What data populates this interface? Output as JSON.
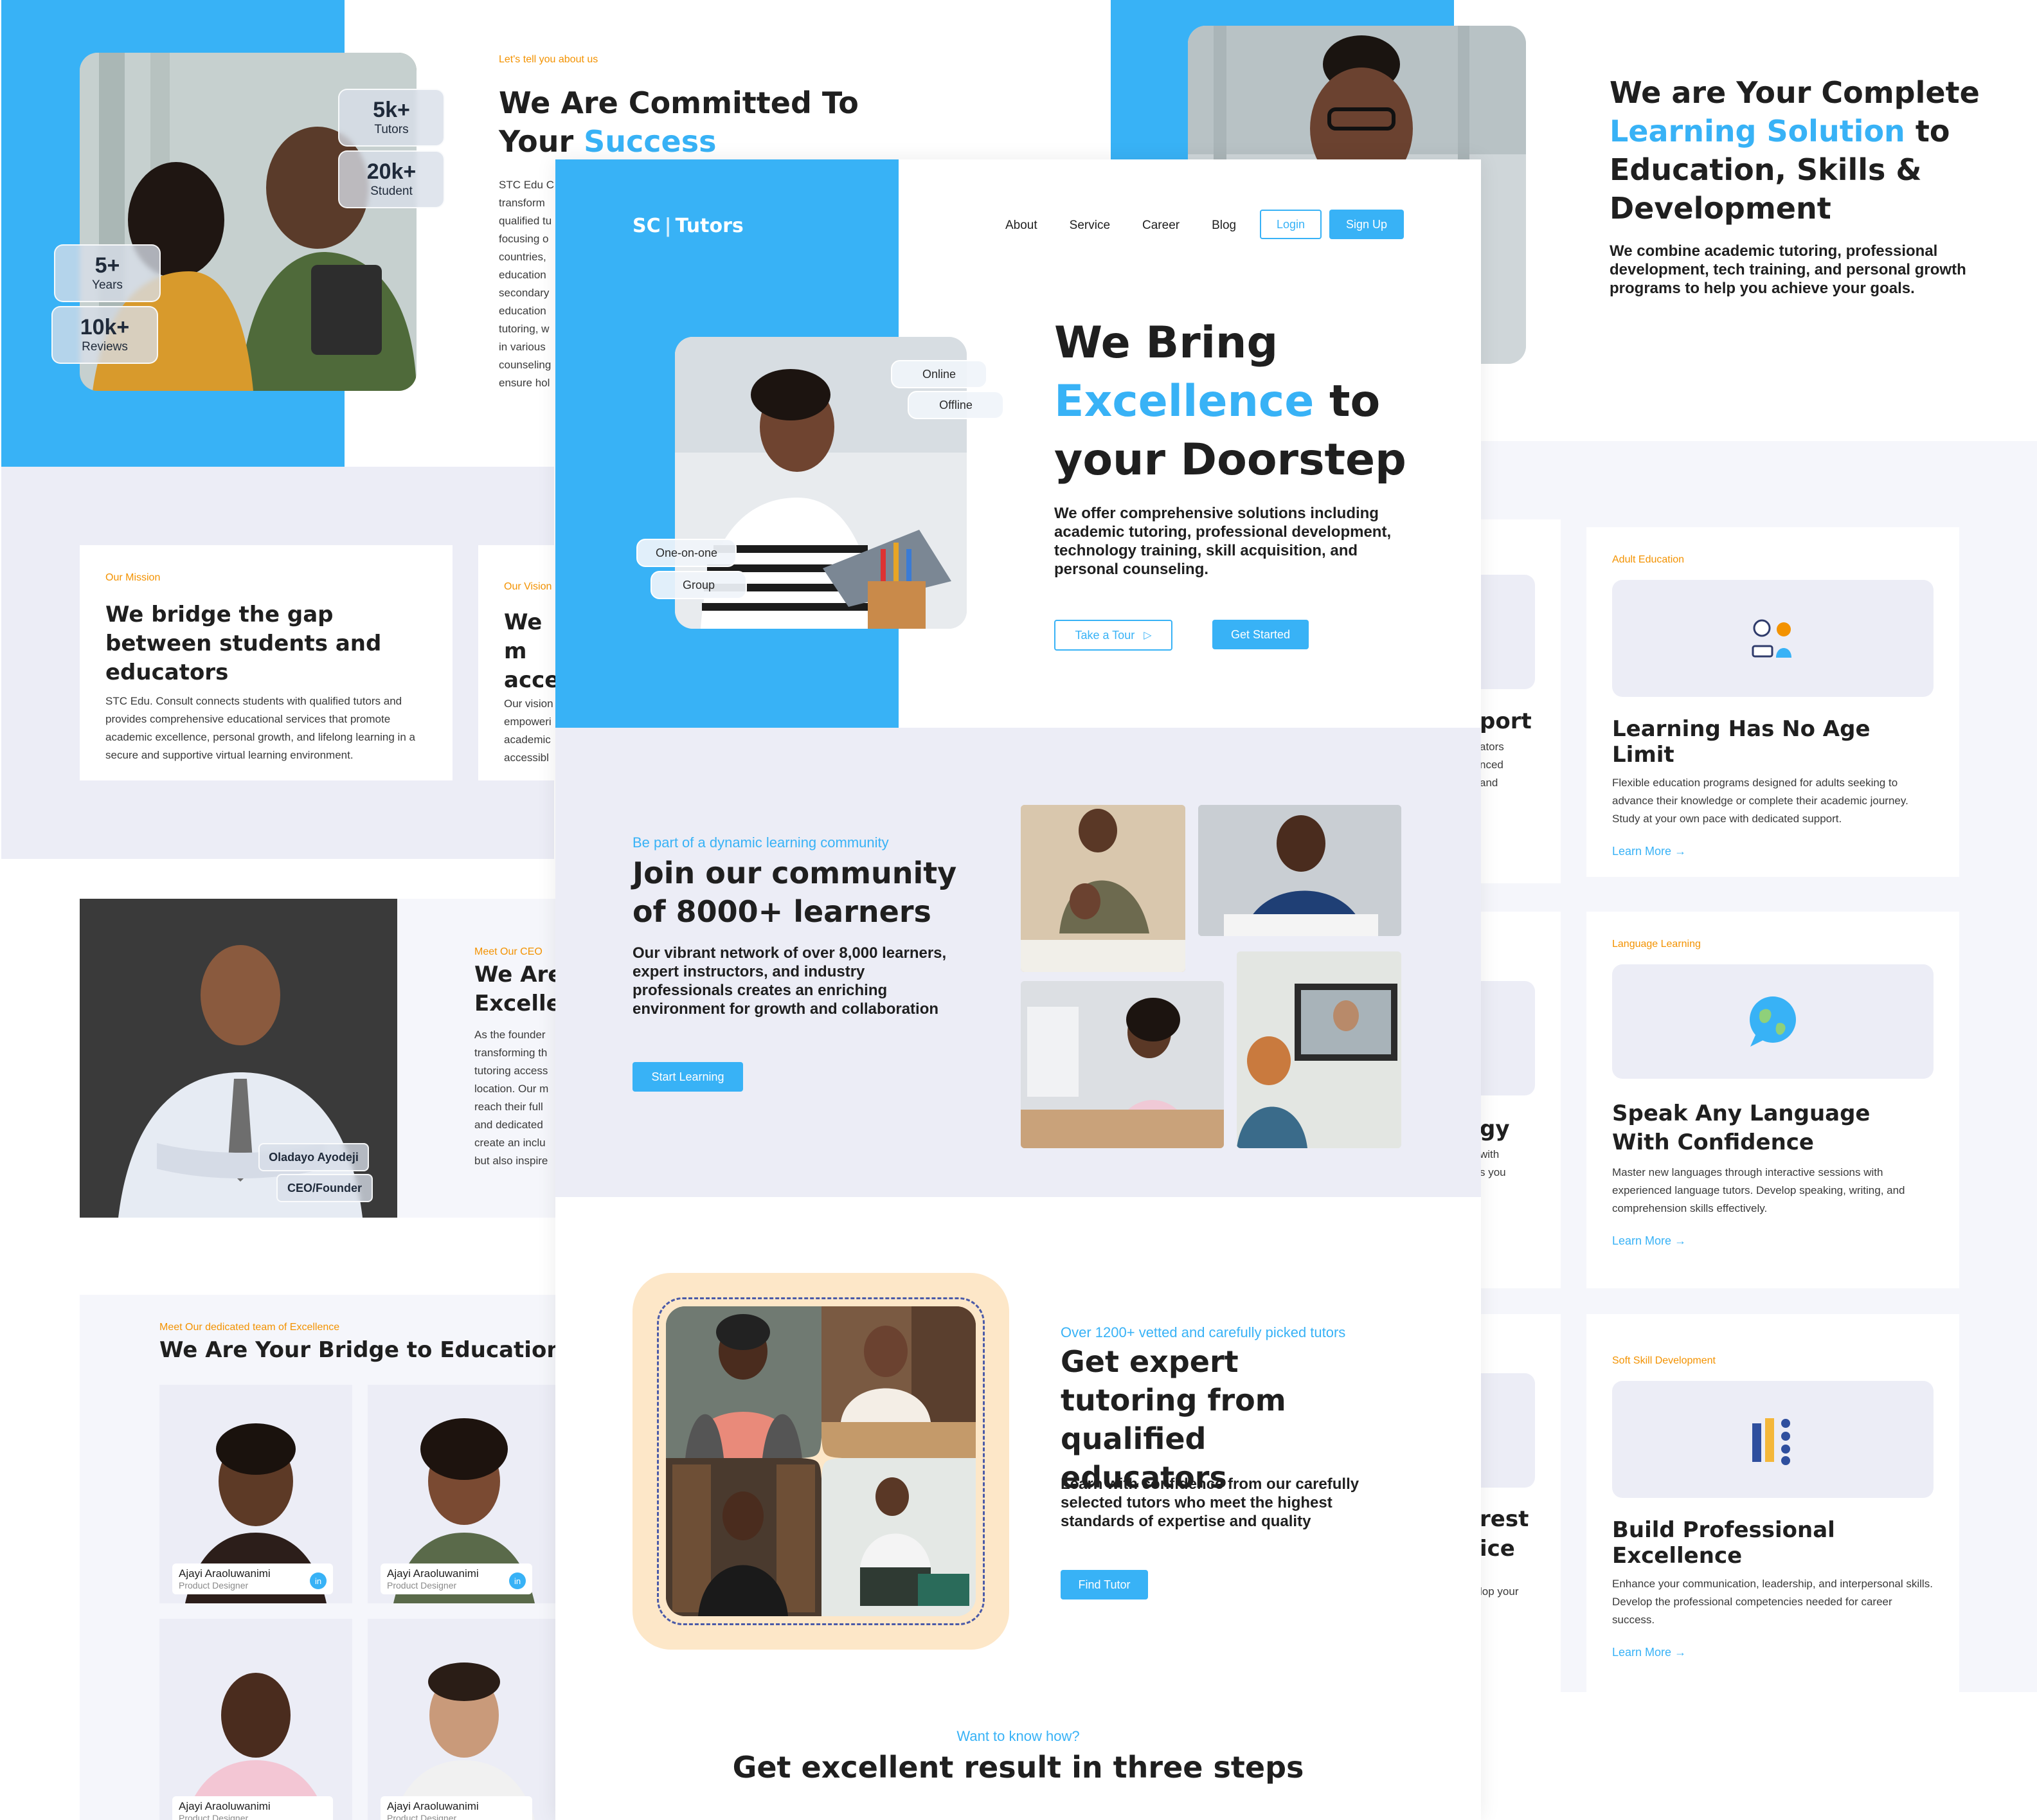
{
  "colors": {
    "accent": "#38b2f6",
    "orange": "#f39200",
    "panel": "#ecedf6",
    "text": "#1f1f1f",
    "cream": "#fde7c8"
  },
  "about": {
    "eyebrow": "Let's tell you about us",
    "title_line1": "We Are Committed To",
    "title_line2_plain": "Your ",
    "title_line2_accent": "Success",
    "text_lines": [
      "STC Edu C",
      "transform",
      "qualified tu",
      "focusing o",
      "countries,",
      "education",
      "secondary",
      "education",
      "tutoring, w",
      "in various",
      "counseling",
      "ensure hol"
    ],
    "stats": [
      {
        "value": "5k+",
        "label": "Tutors"
      },
      {
        "value": "20k+",
        "label": "Student"
      },
      {
        "value": "5+",
        "label": "Years"
      },
      {
        "value": "10k+",
        "label": "Reviews"
      }
    ]
  },
  "complete": {
    "line1": "We are Your Complete",
    "line2_accent": "Learning Solution",
    "line2_plain": " to",
    "line3": "Education, Skills &",
    "line4": "Development",
    "body": "We combine academic tutoring, professional development, tech training, and personal growth programs to help you achieve your goals."
  },
  "mission": {
    "eyebrow": "Our Mission",
    "title": "We bridge the gap between students and educators",
    "body": "STC Edu. Consult connects students with qualified tutors and provides comprehensive educational services that promote academic excellence, personal growth, and lifelong learning in a secure and supportive virtual learning environment."
  },
  "vision": {
    "eyebrow": "Our Vision",
    "title_lines": [
      "We m",
      "acces"
    ],
    "body_lines": [
      "Our vision",
      "empoweri",
      "academic",
      "accessibl"
    ]
  },
  "ceo": {
    "eyebrow": "Meet Our CEO",
    "title_lines": [
      "We Are",
      "Exceller"
    ],
    "body_lines": [
      "As the founder",
      "transforming th",
      "tutoring access",
      "location. Our m",
      "reach their full",
      "and dedicated",
      "create an inclu",
      "but also inspire"
    ],
    "name": "Oladayo Ayodeji",
    "role": "CEO/Founder"
  },
  "team": {
    "eyebrow": "Meet Our dedicated team of Excellence",
    "title": "We Are Your Bridge to Educational Ex",
    "members": [
      {
        "name": "Ajayi Araoluwanimi",
        "role": "Product Designer"
      },
      {
        "name": "Ajayi Araoluwanimi",
        "role": "Product Designer"
      },
      {
        "name": "Ajayi Araoluwanimi",
        "role": "Product Designer"
      },
      {
        "name": "Ajayi Araoluwanimi",
        "role": "Product Designer"
      }
    ]
  },
  "nav": {
    "logo_mark": "SC",
    "logo_text": "Tutors",
    "links": [
      "About",
      "Service",
      "Career",
      "Blog"
    ],
    "login": "Login",
    "signup": "Sign Up"
  },
  "hero": {
    "line1": "We Bring",
    "line2_accent": "Excellence",
    "line2_plain": " to",
    "line3": "your Doorstep",
    "body": "We offer comprehensive solutions including academic tutoring, professional development, technology training, skill acquisition, and personal counseling.",
    "tour": "Take a Tour",
    "start": "Get Started",
    "chips": [
      "Online",
      "Offline",
      "One-on-one",
      "Group"
    ]
  },
  "community": {
    "eyebrow": "Be part of a dynamic learning community",
    "title": "Join our community of 8000+ learners",
    "body": "Our vibrant network of over 8,000 learners, expert instructors, and industry professionals creates an enriching environment for growth and collaboration",
    "button": "Start Learning"
  },
  "tutors": {
    "eyebrow": "Over 1200+ vetted and carefully picked tutors",
    "title": "Get expert tutoring from qualified educators",
    "body": "Learn with confidence from our carefully selected tutors who meet the highest standards of expertise and quality",
    "button": "Find Tutor"
  },
  "steps": {
    "eyebrow": "Want to know how?",
    "title": "Get excellent result in three steps"
  },
  "services_partial": {
    "pieces": [
      "port",
      "ators",
      "nced",
      "and",
      "gy",
      "with",
      "s you",
      "rest",
      "ice",
      "lop your"
    ]
  },
  "services": [
    {
      "eyebrow": "Adult Education",
      "title": "Learning Has No Age Limit",
      "body": "Flexible education programs designed for adults seeking to advance their knowledge or complete their academic journey. Study at your own pace with dedicated support.",
      "link": "Learn More",
      "icon": "people-icon"
    },
    {
      "eyebrow": "Language Learning",
      "title": "Speak Any Language With Confidence",
      "body": "Master new languages through interactive sessions with experienced language tutors. Develop speaking, writing, and comprehension skills effectively.",
      "link": "Learn More",
      "icon": "globe-chat-icon"
    },
    {
      "eyebrow": "Soft Skill Development",
      "title": "Build Professional Excellence",
      "body": "Enhance your communication, leadership, and interpersonal skills. Develop the professional competencies needed for career success.",
      "link": "Learn More",
      "icon": "team-icon"
    }
  ]
}
